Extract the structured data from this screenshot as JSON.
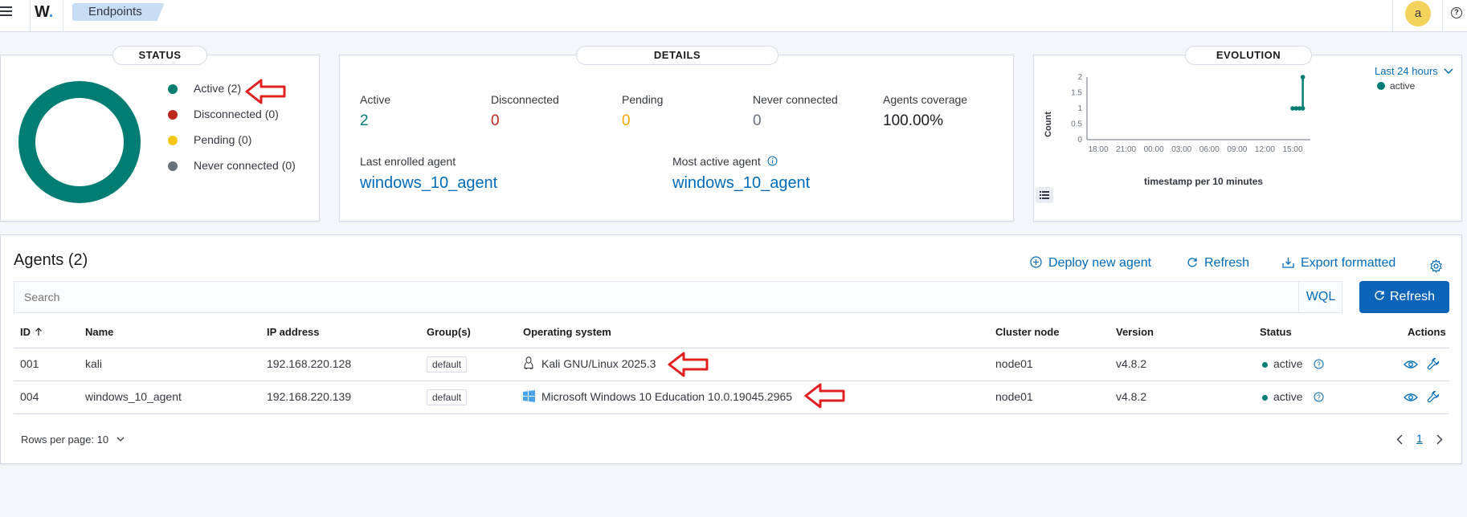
{
  "header": {
    "logo": "W",
    "breadcrumb": "Endpoints",
    "avatar": "a",
    "help_icon": "question-icon"
  },
  "status": {
    "title": "STATUS",
    "legend": [
      {
        "label": "Active (2)",
        "color": "#017d73"
      },
      {
        "label": "Disconnected (0)",
        "color": "#bd271e"
      },
      {
        "label": "Pending (0)",
        "color": "#f5c518"
      },
      {
        "label": "Never connected (0)",
        "color": "#69707d"
      }
    ]
  },
  "details": {
    "title": "DETAILS",
    "stats": [
      {
        "label": "Active",
        "value": "2",
        "color": "#017d73"
      },
      {
        "label": "Disconnected",
        "value": "0",
        "color": "#bd271e"
      },
      {
        "label": "Pending",
        "value": "0",
        "color": "#f5a700"
      },
      {
        "label": "Never connected",
        "value": "0",
        "color": "#69707d"
      },
      {
        "label": "Agents coverage",
        "value": "100.00%",
        "color": "#1a1c21"
      }
    ],
    "last_enrolled_label": "Last enrolled agent",
    "last_enrolled_value": "windows_10_agent",
    "most_active_label": "Most active agent",
    "most_active_value": "windows_10_agent"
  },
  "evolution": {
    "title": "EVOLUTION",
    "range": "Last 24 hours",
    "legend": "active",
    "ylabel": "Count",
    "xlabel": "timestamp per 10 minutes",
    "yticks": [
      "2",
      "1.5",
      "1",
      "0.5",
      "0"
    ],
    "xticks": [
      "18:00",
      "21:00",
      "00:00",
      "03:00",
      "06:00",
      "09:00",
      "12:00",
      "15:00"
    ]
  },
  "chart_data": {
    "type": "line",
    "title": "",
    "xlabel": "timestamp per 10 minutes",
    "ylabel": "Count",
    "ylim": [
      0,
      2
    ],
    "series": [
      {
        "name": "active",
        "color": "#017d73",
        "x": [
          "15:00",
          "15:10",
          "15:20",
          "15:30",
          "15:40"
        ],
        "values": [
          1,
          1,
          1,
          1,
          2
        ]
      }
    ]
  },
  "agents": {
    "title": "Agents (2)",
    "deploy_label": "Deploy new agent",
    "refresh_label": "Refresh",
    "export_label": "Export formatted",
    "search_placeholder": "Search",
    "wql_label": "WQL",
    "refresh_button": "Refresh",
    "columns": [
      "ID",
      "Name",
      "IP address",
      "Group(s)",
      "Operating system",
      "Cluster node",
      "Version",
      "Status",
      "Actions"
    ],
    "rows": [
      {
        "id": "001",
        "name": "kali",
        "ip": "192.168.220.128",
        "group": "default",
        "os": "Kali GNU/Linux 2025.3",
        "os_icon": "linux-icon",
        "node": "node01",
        "version": "v4.8.2",
        "status": "active"
      },
      {
        "id": "004",
        "name": "windows_10_agent",
        "ip": "192.168.220.139",
        "group": "default",
        "os": "Microsoft Windows 10 Education 10.0.19045.2965",
        "os_icon": "windows-icon",
        "node": "node01",
        "version": "v4.8.2",
        "status": "active"
      }
    ],
    "rows_per_page": "Rows per page: 10",
    "page": "1"
  }
}
